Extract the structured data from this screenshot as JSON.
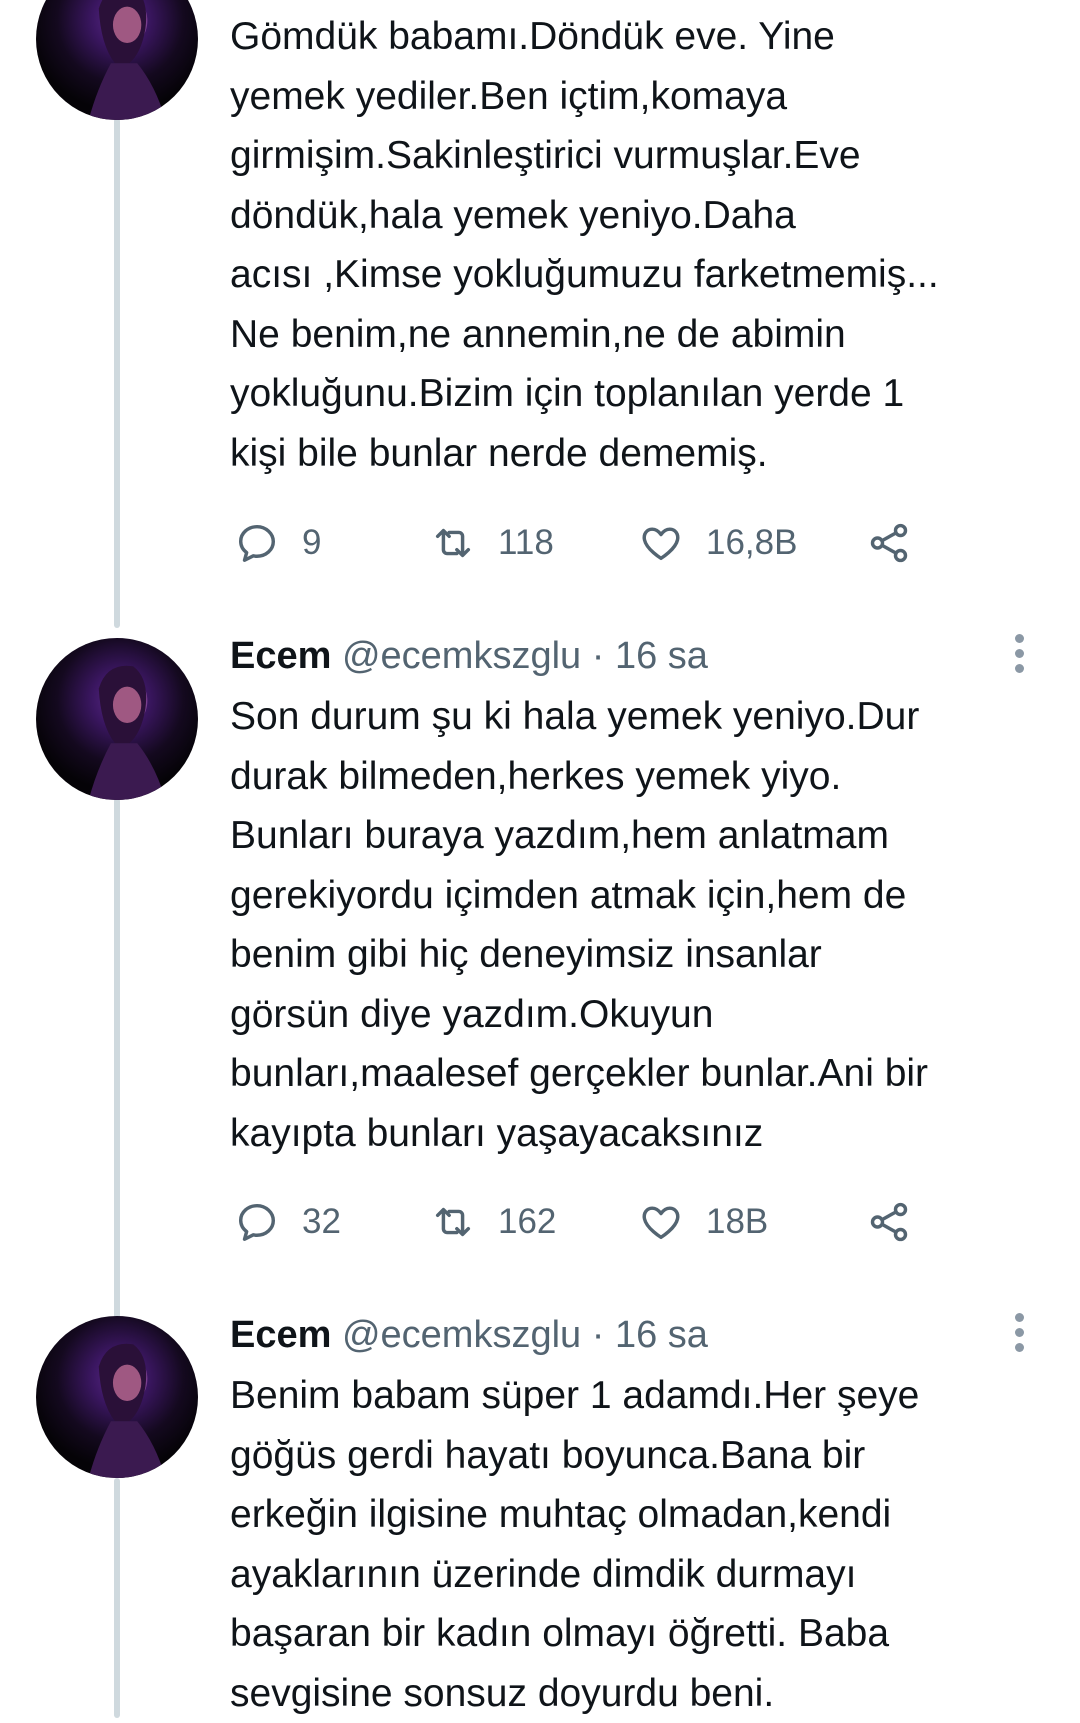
{
  "tweets": [
    {
      "lines": [
        "Gömdük babamı.Döndük eve. Yine",
        "yemek yediler.Ben içtim,komaya",
        "girmişim.Sakinleştirici vurmuşlar.Eve",
        "döndük,hala yemek yeniyo.Daha",
        "acısı ,Kimse yokluğumuzu farketmemiş...",
        "Ne benim,ne annemin,ne de abimin",
        "yokluğunu.Bizim için toplanılan yerde 1",
        "kişi bile bunlar nerde dememiş."
      ],
      "replies": "9",
      "retweets": "118",
      "likes": "16,8B"
    },
    {
      "name": "Ecem",
      "handle": "@ecemkszglu",
      "separator": "·",
      "time": "16 sa",
      "lines": [
        "Son durum şu ki hala yemek yeniyo.Dur",
        "durak bilmeden,herkes yemek yiyo.",
        "Bunları buraya yazdım,hem anlatmam",
        "gerekiyordu içimden atmak için,hem de",
        "benim gibi hiç deneyimsiz insanlar",
        "görsün diye yazdım.Okuyun",
        "bunları,maalesef gerçekler bunlar.Ani bir",
        "kayıpta bunları yaşayacaksınız"
      ],
      "replies": "32",
      "retweets": "162",
      "likes": "18B"
    },
    {
      "name": "Ecem",
      "handle": "@ecemkszglu",
      "separator": "·",
      "time": "16 sa",
      "lines": [
        "Benim babam süper 1 adamdı.Her şeye",
        "göğüs gerdi hayatı boyunca.Bana bir",
        "erkeğin ilgisine muhtaç olmadan,kendi",
        "ayaklarının üzerinde dimdik durmayı",
        "başaran bir kadın olmayı öğretti. Baba",
        "sevgisine sonsuz doyurdu beni."
      ]
    }
  ],
  "icons": {
    "reply": "reply-icon",
    "retweet": "retweet-icon",
    "like": "like-icon",
    "share": "share-icon",
    "more": "more-icon"
  },
  "colors": {
    "text": "#0f1419",
    "muted": "#536471",
    "thread_line": "#cfd9de",
    "avatar_accent": "#5b2a8a"
  }
}
